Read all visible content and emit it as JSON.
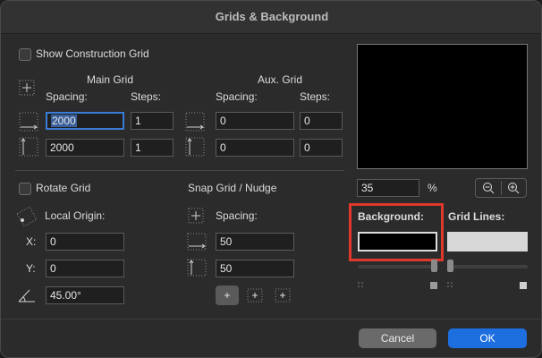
{
  "window": {
    "title": "Grids & Background"
  },
  "construction": {
    "show_label": "Show Construction Grid"
  },
  "main_grid": {
    "title": "Main Grid",
    "spacing_label": "Spacing:",
    "steps_label": "Steps:",
    "h_spacing": "2000",
    "h_steps": "1",
    "v_spacing": "2000",
    "v_steps": "1"
  },
  "aux_grid": {
    "title": "Aux. Grid",
    "spacing_label": "Spacing:",
    "steps_label": "Steps:",
    "h_spacing": "0",
    "h_steps": "0",
    "v_spacing": "0",
    "v_steps": "0"
  },
  "rotate": {
    "label": "Rotate Grid",
    "origin_label": "Local Origin:",
    "x_label": "X:",
    "x_value": "0",
    "y_label": "Y:",
    "y_value": "0",
    "angle_value": "45.00°"
  },
  "snap": {
    "title": "Snap Grid / Nudge",
    "spacing_label": "Spacing:",
    "h_value": "50",
    "v_value": "50"
  },
  "preview": {
    "zoom_value": "35",
    "zoom_unit": "%"
  },
  "colors": {
    "background_label": "Background:",
    "gridlines_label": "Grid Lines:",
    "background_color": "#000000",
    "gridlines_color": "#d8d8d8",
    "highlight": "#e0392b"
  },
  "footer": {
    "cancel_label": "Cancel",
    "ok_label": "OK"
  }
}
